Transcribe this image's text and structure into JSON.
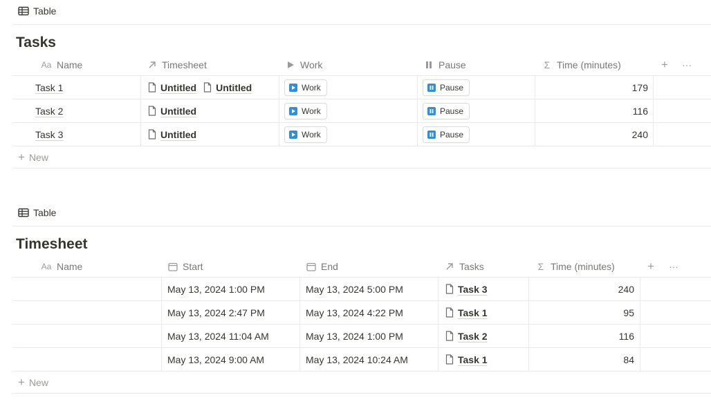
{
  "view_label": "Table",
  "tasks": {
    "title": "Tasks",
    "columns": {
      "name": "Name",
      "timesheet": "Timesheet",
      "work": "Work",
      "pause": "Pause",
      "time": "Time (minutes)"
    },
    "rows": [
      {
        "name": "Task 1",
        "timesheet": [
          "Untitled",
          "Untitled"
        ],
        "work": "Work",
        "pause": "Pause",
        "time": "179"
      },
      {
        "name": "Task 2",
        "timesheet": [
          "Untitled"
        ],
        "work": "Work",
        "pause": "Pause",
        "time": "116"
      },
      {
        "name": "Task 3",
        "timesheet": [
          "Untitled"
        ],
        "work": "Work",
        "pause": "Pause",
        "time": "240"
      }
    ],
    "new_label": "New"
  },
  "timesheet": {
    "title": "Timesheet",
    "columns": {
      "name": "Name",
      "start": "Start",
      "end": "End",
      "tasks": "Tasks",
      "time": "Time (minutes)"
    },
    "rows": [
      {
        "name": "",
        "start": "May 13, 2024 1:00 PM",
        "end": "May 13, 2024 5:00 PM",
        "task": "Task 3",
        "time": "240"
      },
      {
        "name": "",
        "start": "May 13, 2024 2:47 PM",
        "end": "May 13, 2024 4:22 PM",
        "task": "Task 1",
        "time": "95"
      },
      {
        "name": "",
        "start": "May 13, 2024 11:04 AM",
        "end": "May 13, 2024 1:00 PM",
        "task": "Task 2",
        "time": "116"
      },
      {
        "name": "",
        "start": "May 13, 2024 9:00 AM",
        "end": "May 13, 2024 10:24 AM",
        "task": "Task 1",
        "time": "84"
      }
    ],
    "new_label": "New"
  },
  "colors": {
    "button_icon": "#2f8fd8",
    "border": "#e9e9e7",
    "muted_text": "#787774"
  }
}
